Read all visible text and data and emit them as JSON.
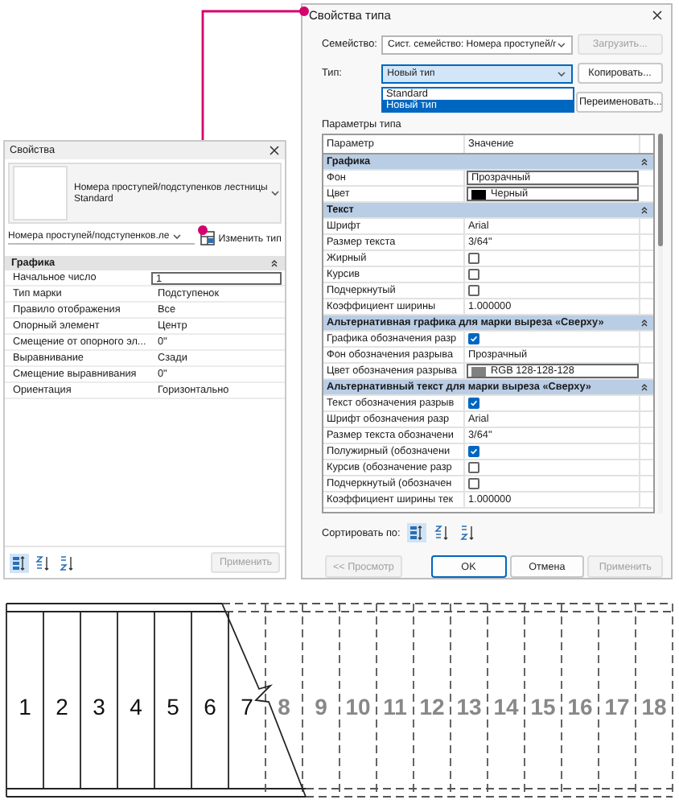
{
  "properties_panel": {
    "title": "Свойства",
    "type_name": "Номера проступей/подступенков лестницы",
    "type_value": "Standard",
    "instance_selector": "Номера проступей/подступенков.ле",
    "edit_type": "Изменить тип",
    "groups": [
      {
        "name": "Графика",
        "expanded": true,
        "rows": [
          {
            "param": "Начальное число",
            "value": "1",
            "kind": "input"
          },
          {
            "param": "Тип марки",
            "value": "Подступенок",
            "kind": "text"
          },
          {
            "param": "Правило отображения",
            "value": "Все",
            "kind": "text"
          },
          {
            "param": "Опорный элемент",
            "value": "Центр",
            "kind": "text"
          },
          {
            "param": "Смещение от опорного эл...",
            "value": "0\"",
            "kind": "text"
          },
          {
            "param": "Выравнивание",
            "value": "Сзади",
            "kind": "text"
          },
          {
            "param": "Смещение выравнивания",
            "value": "0\"",
            "kind": "text"
          },
          {
            "param": "Ориентация",
            "value": "Горизонтально",
            "kind": "text"
          }
        ]
      }
    ],
    "sort_options": [
      {
        "kind": "category",
        "selected": true
      },
      {
        "kind": "ascending",
        "selected": false
      },
      {
        "kind": "descending",
        "selected": false
      }
    ],
    "apply": {
      "label": "Применить",
      "disabled": true
    }
  },
  "type_dialog": {
    "title": "Свойства типа",
    "family_label": "Семейство:",
    "family_value": "Сист. семейство: Номера проступей/г",
    "load_button": {
      "label": "Загрузить...",
      "disabled": true
    },
    "type_label": "Тип:",
    "type_value": "Новый тип",
    "type_options": [
      {
        "label": "Standard",
        "selected": false
      },
      {
        "label": "Новый тип",
        "selected": true
      }
    ],
    "copy_button": {
      "label": "Копировать...",
      "disabled": false
    },
    "rename_button": {
      "label": "Переименовать...",
      "disabled": false
    },
    "params_label": "Параметры типа",
    "columns": [
      "Параметр",
      "Значение"
    ],
    "groups": [
      {
        "name": "Графика",
        "expanded": true,
        "rows": [
          {
            "param": "Фон",
            "value": "Прозрачный",
            "kind": "input"
          },
          {
            "param": "Цвет",
            "value": "Черный",
            "kind": "color",
            "color": "#000000"
          }
        ]
      },
      {
        "name": "Текст",
        "expanded": true,
        "rows": [
          {
            "param": "Шрифт",
            "value": "Arial",
            "kind": "text"
          },
          {
            "param": "Размер текста",
            "value": "3/64\"",
            "kind": "text"
          },
          {
            "param": "Жирный",
            "kind": "checkbox",
            "checked": false
          },
          {
            "param": "Курсив",
            "kind": "checkbox",
            "checked": false
          },
          {
            "param": "Подчеркнутый",
            "kind": "checkbox",
            "checked": false
          },
          {
            "param": "Коэффициент ширины",
            "value": "1.000000",
            "kind": "text"
          }
        ]
      },
      {
        "name": "Альтернативная графика для марки выреза «Сверху»",
        "expanded": true,
        "rows": [
          {
            "param": "Графика обозначения разр",
            "kind": "checkbox",
            "checked": true
          },
          {
            "param": "Фон обозначения разрыва",
            "value": "Прозрачный",
            "kind": "text"
          },
          {
            "param": "Цвет обозначения разрыва",
            "value": "RGB 128-128-128",
            "kind": "color",
            "color": "#808080"
          }
        ]
      },
      {
        "name": "Альтернативный текст для марки выреза «Сверху»",
        "expanded": true,
        "rows": [
          {
            "param": "Текст обозначения разрыв",
            "kind": "checkbox",
            "checked": true
          },
          {
            "param": "Шрифт обозначения разр",
            "value": "Arial",
            "kind": "text"
          },
          {
            "param": "Размер текста обозначени",
            "value": "3/64\"",
            "kind": "text"
          },
          {
            "param": "Полужирный (обозначени",
            "kind": "checkbox",
            "checked": true
          },
          {
            "param": "Курсив (обозначение разр",
            "kind": "checkbox",
            "checked": false
          },
          {
            "param": "Подчеркнутый (обозначен",
            "kind": "checkbox",
            "checked": false
          },
          {
            "param": "Коэффициент ширины тек",
            "value": "1.000000",
            "kind": "text"
          }
        ]
      }
    ],
    "sort_label": "Сортировать по:",
    "sort_options": [
      {
        "kind": "category",
        "selected": true
      },
      {
        "kind": "ascending",
        "selected": false
      },
      {
        "kind": "descending",
        "selected": false
      }
    ],
    "buttons": [
      {
        "label": "<< Просмотр",
        "disabled": true,
        "default": false
      },
      {
        "label": "OK",
        "disabled": false,
        "default": true
      },
      {
        "label": "Отмена",
        "disabled": false,
        "default": false
      },
      {
        "label": "Применить",
        "disabled": true,
        "default": false
      }
    ]
  },
  "stair": {
    "treads": [
      {
        "number": "1",
        "kind": "visible"
      },
      {
        "number": "2",
        "kind": "visible"
      },
      {
        "number": "3",
        "kind": "visible"
      },
      {
        "number": "4",
        "kind": "visible"
      },
      {
        "number": "5",
        "kind": "visible"
      },
      {
        "number": "6",
        "kind": "visible"
      },
      {
        "number": "7",
        "kind": "visible"
      },
      {
        "number": "8",
        "kind": "hidden"
      },
      {
        "number": "9",
        "kind": "hidden"
      },
      {
        "number": "10",
        "kind": "hidden"
      },
      {
        "number": "11",
        "kind": "hidden"
      },
      {
        "number": "12",
        "kind": "hidden"
      },
      {
        "number": "13",
        "kind": "hidden"
      },
      {
        "number": "14",
        "kind": "hidden"
      },
      {
        "number": "15",
        "kind": "hidden"
      },
      {
        "number": "16",
        "kind": "hidden"
      },
      {
        "number": "17",
        "kind": "hidden"
      },
      {
        "number": "18",
        "kind": "hidden"
      }
    ]
  }
}
